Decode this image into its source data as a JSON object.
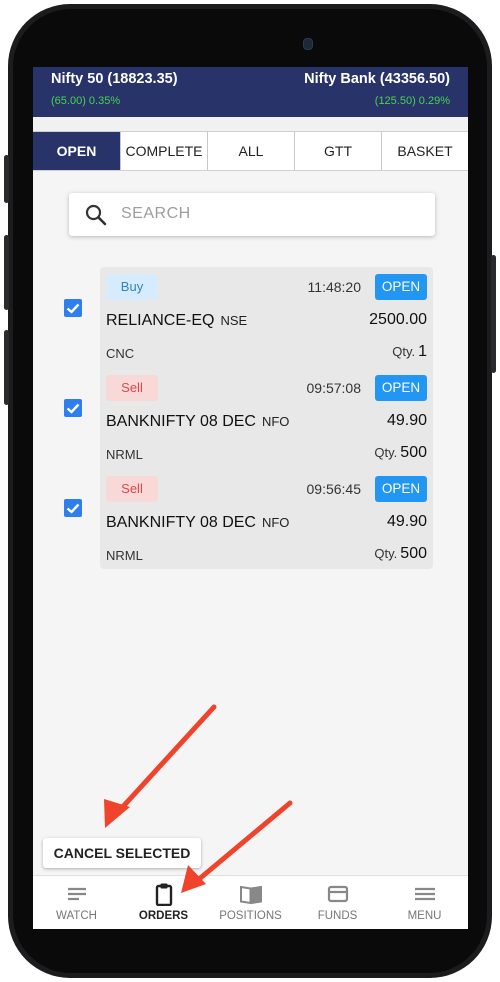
{
  "ticker": [
    {
      "name": "Nifty 50 (18823.35)",
      "change": "(65.00) 0.35%"
    },
    {
      "name": "Nifty Bank (43356.50)",
      "change": "(125.50) 0.29%"
    }
  ],
  "tabs": [
    "OPEN",
    "COMPLETE",
    "ALL",
    "GTT",
    "BASKET"
  ],
  "active_tab": "OPEN",
  "search": {
    "placeholder": "SEARCH",
    "icon": "search-icon"
  },
  "orders": [
    {
      "side": "Buy",
      "time": "11:48:20",
      "status": "OPEN",
      "symbol": "RELIANCE-EQ",
      "exchange": "NSE",
      "price": "2500.00",
      "product": "CNC",
      "qty_label": "Qty.",
      "qty": "1",
      "selected": true
    },
    {
      "side": "Sell",
      "time": "09:57:08",
      "status": "OPEN",
      "symbol": "BANKNIFTY 08 DEC",
      "exchange": "NFO",
      "price": "49.90",
      "product": "NRML",
      "qty_label": "Qty.",
      "qty": "500",
      "selected": true
    },
    {
      "side": "Sell",
      "time": "09:56:45",
      "status": "OPEN",
      "symbol": "BANKNIFTY 08 DEC",
      "exchange": "NFO",
      "price": "49.90",
      "product": "NRML",
      "qty_label": "Qty.",
      "qty": "500",
      "selected": true
    }
  ],
  "cancel_button": "CANCEL SELECTED",
  "nav": [
    {
      "label": "WATCH",
      "icon": "menu-lines-icon"
    },
    {
      "label": "ORDERS",
      "icon": "clipboard-icon"
    },
    {
      "label": "POSITIONS",
      "icon": "book-icon"
    },
    {
      "label": "FUNDS",
      "icon": "card-icon"
    },
    {
      "label": "MENU",
      "icon": "hamburger-icon"
    }
  ],
  "active_nav": "ORDERS",
  "colors": {
    "header": "#283469",
    "positive": "#47d34f",
    "open_badge": "#2196f3",
    "buy_badge_bg": "#d6ebfb",
    "sell_badge_bg": "#f9d8d8",
    "checkbox": "#2f7ef0",
    "annotation_arrow": "#f0432b"
  }
}
